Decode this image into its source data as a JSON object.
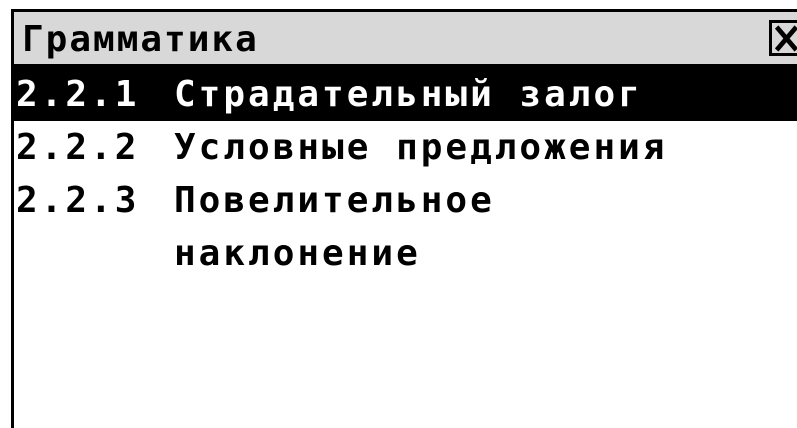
{
  "window": {
    "title": "Грамматика",
    "close_icon": "close-icon"
  },
  "items": [
    {
      "number": "2.2.1",
      "label": "Страдательный залог",
      "selected": true
    },
    {
      "number": "2.2.2",
      "label": "Условные предложения",
      "selected": false
    },
    {
      "number": "2.2.3",
      "label": "Повелительное",
      "label_line2": "наклонение",
      "selected": false
    }
  ]
}
